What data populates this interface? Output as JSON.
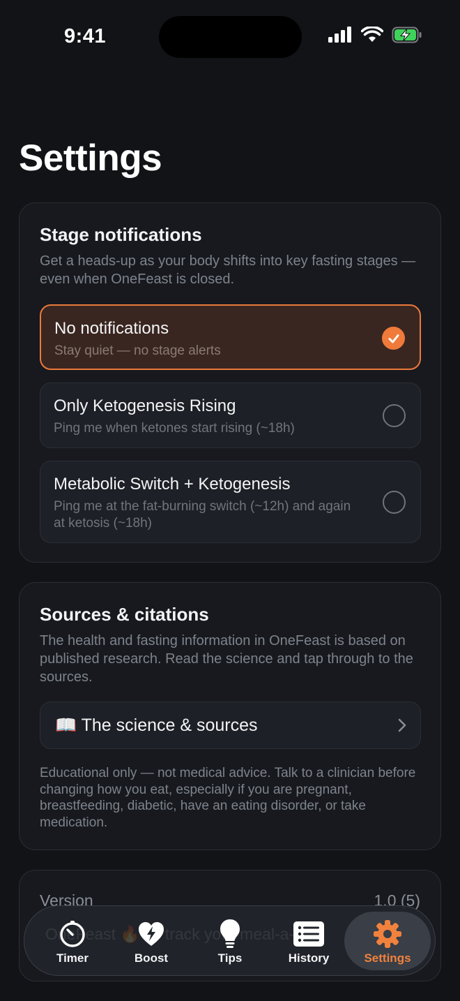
{
  "status_bar": {
    "time": "9:41"
  },
  "page": {
    "title": "Settings"
  },
  "notifications": {
    "title": "Stage notifications",
    "description": "Get a heads-up as your body shifts into key fasting stages — even when OneFeast is closed.",
    "options": [
      {
        "title": "No notifications",
        "subtitle": "Stay quiet — no stage alerts",
        "selected": true
      },
      {
        "title": "Only Ketogenesis Rising",
        "subtitle": "Ping me when ketones start rising (~18h)",
        "selected": false
      },
      {
        "title": "Metabolic Switch + Ketogenesis",
        "subtitle": "Ping me at the fat-burning switch (~12h) and again at ketosis (~18h)",
        "selected": false
      }
    ]
  },
  "sources": {
    "title": "Sources & citations",
    "description": "The health and fasting information in OneFeast is based on published research. Read the science and tap through to the sources.",
    "link_label": "📖 The science & sources",
    "disclaimer": "Educational only — not medical advice. Talk to a clinician before changing how you eat, especially if you are pregnant, breastfeeding, diabetic, have an eating disorder, or take medication."
  },
  "version": {
    "label": "Version",
    "value": "1.0 (5)"
  },
  "tab_bar": {
    "ghost_text": "OneFeast 🔥 — track your meal-a-day",
    "tabs": [
      {
        "label": "Timer",
        "icon": "timer-icon",
        "active": false
      },
      {
        "label": "Boost",
        "icon": "heart-bolt-icon",
        "active": false
      },
      {
        "label": "Tips",
        "icon": "lightbulb-icon",
        "active": false
      },
      {
        "label": "History",
        "icon": "list-icon",
        "active": false
      },
      {
        "label": "Settings",
        "icon": "gear-icon",
        "active": true
      }
    ]
  },
  "colors": {
    "accent": "#ef7a3a",
    "background": "#111317",
    "card": "#17191e"
  }
}
